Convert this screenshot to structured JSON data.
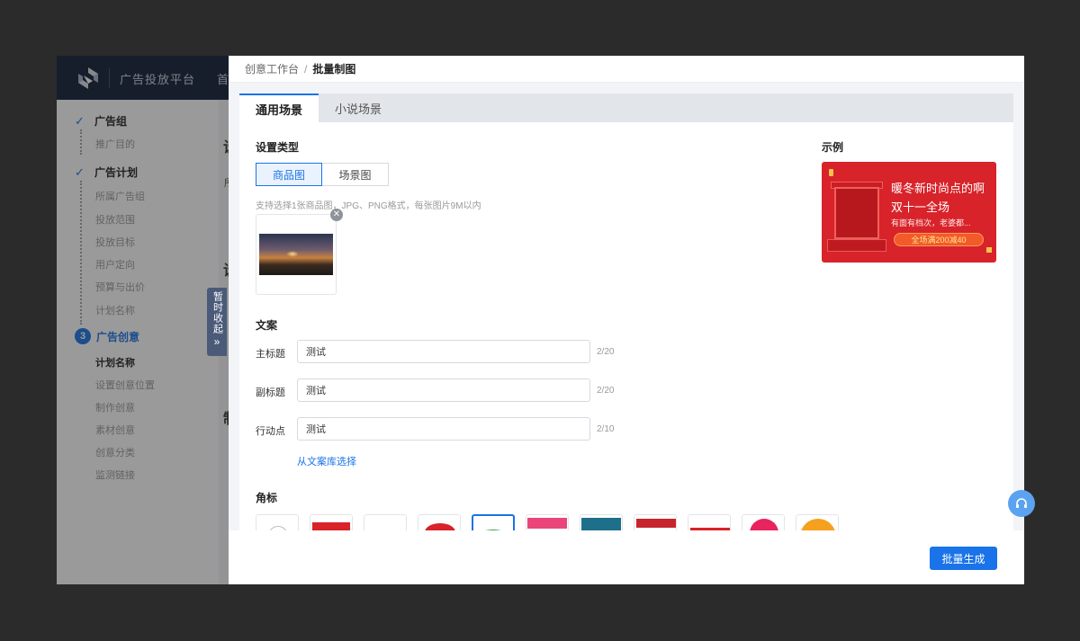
{
  "app": {
    "title": "广告投放平台",
    "nav_first": "首"
  },
  "sidebar": {
    "step1": {
      "label": "广告组",
      "items": [
        "推广目的"
      ]
    },
    "step2": {
      "label": "广告计划",
      "items": [
        "所属广告组",
        "投放范围",
        "投放目标",
        "用户定向",
        "预算与出价",
        "计划名称"
      ]
    },
    "step3": {
      "number": "3",
      "label": "广告创意",
      "items": [
        "计划名称",
        "设置创意位置",
        "制作创意",
        "素材创意",
        "创意分类",
        "监测链接"
      ]
    }
  },
  "main_bg": {
    "heading_a": "设",
    "heading_b": "设",
    "heading_c": "制",
    "sub_a": "所"
  },
  "collapse_tab": {
    "text": "暂时收起",
    "arrows": "»"
  },
  "breadcrumb": {
    "root": "创意工作台",
    "sep": "/",
    "current": "批量制图"
  },
  "tabs": [
    {
      "label": "通用场景"
    },
    {
      "label": "小说场景"
    }
  ],
  "settings": {
    "type_title": "设置类型",
    "types": [
      "商品图",
      "场景图"
    ],
    "upload_hint": "支持选择1张商品图，JPG、PNG格式，每张图片9M以内",
    "remove_icon": "✕"
  },
  "copy": {
    "section_title": "文案",
    "fields": [
      {
        "label": "主标题",
        "value": "测试",
        "counter": "2/20"
      },
      {
        "label": "副标题",
        "value": "测试",
        "counter": "2/20"
      },
      {
        "label": "行动点",
        "value": "测试",
        "counter": "2/10"
      }
    ],
    "library_link": "从文案库选择"
  },
  "corner_badges": {
    "section_title": "角标",
    "items": [
      "none",
      "hot-product",
      "blank",
      "red-seal",
      "green-wave",
      "popular-pick",
      "business",
      "direct-sale",
      "red-ribbon",
      "pink-circle",
      "orange-circle"
    ]
  },
  "example": {
    "section_title": "示例",
    "title": "暖冬新时尚点的啊",
    "subtitle": "双十一全场",
    "line": "有面有档次，老婆都...",
    "pill": "全场满200减40"
  },
  "footer": {
    "generate_label": "批量生成"
  },
  "colors": {
    "accent": "#1a73e8",
    "topbar": "#121e36",
    "example_bg": "#d8232a"
  }
}
